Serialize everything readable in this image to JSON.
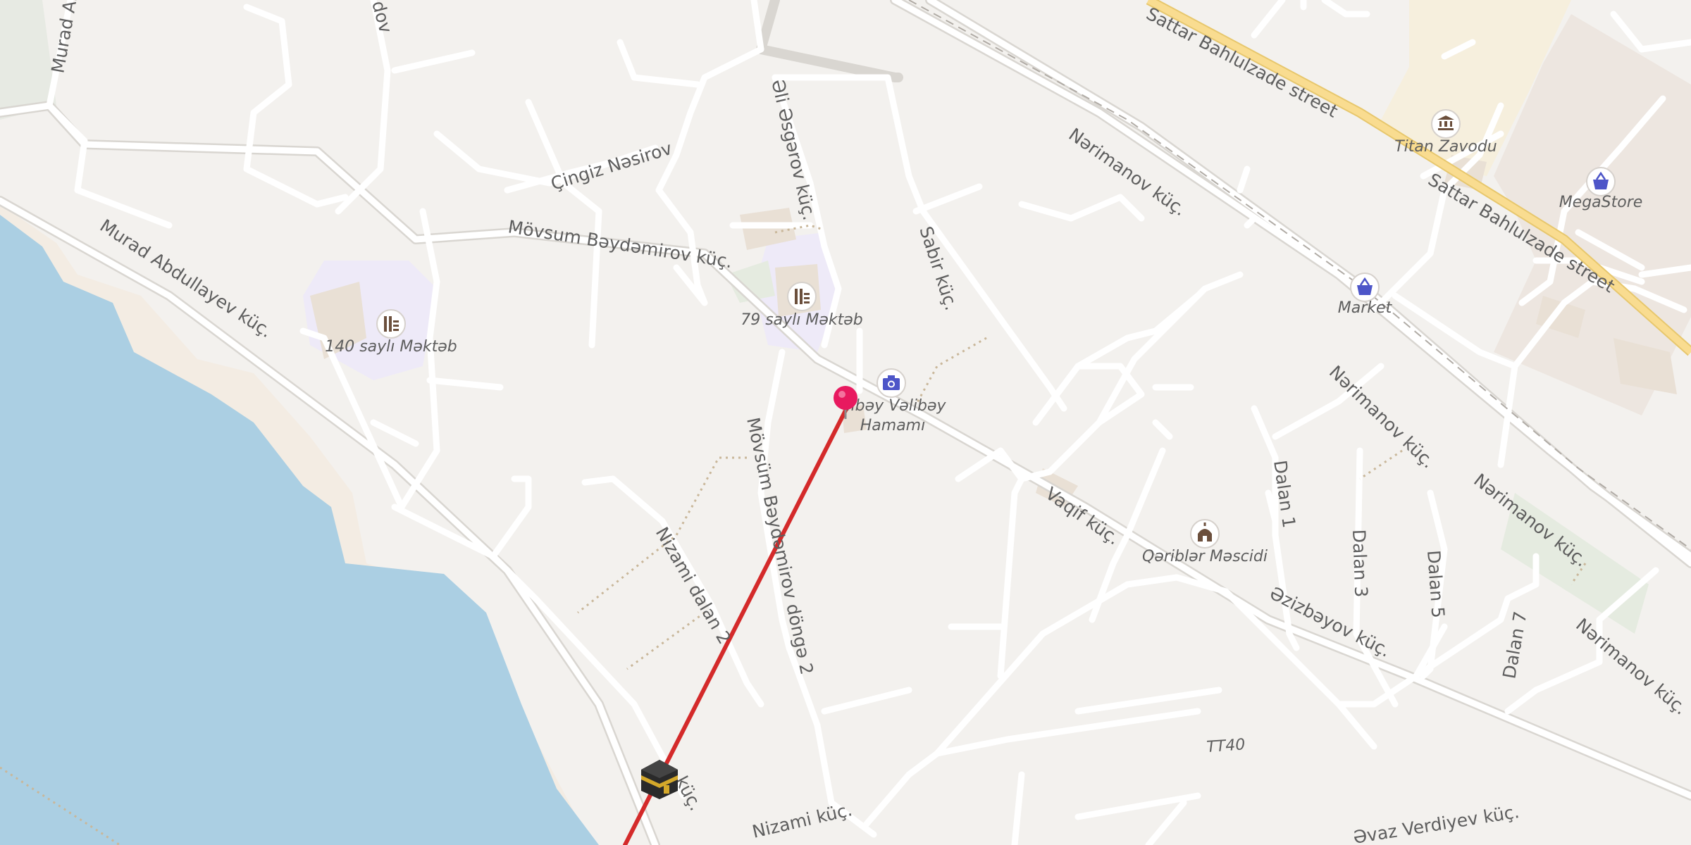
{
  "map": {
    "street_labels": [
      {
        "id": "sattar-1",
        "text": "Sattar Bahlulzade street"
      },
      {
        "id": "sattar-2",
        "text": "Sattar Bahlulzade street"
      },
      {
        "id": "narimanov-1",
        "text": "Nərimanov küç."
      },
      {
        "id": "narimanov-2",
        "text": "Nərimanov küç."
      },
      {
        "id": "narimanov-3",
        "text": "Nərimanov küç."
      },
      {
        "id": "narimanov-4",
        "text": "Nərimanov küç."
      },
      {
        "id": "ali-asgarov",
        "text": "Əli Əsgərov küç."
      },
      {
        "id": "cingiz",
        "text": "Çingiz Nəsirov"
      },
      {
        "id": "movsum-1",
        "text": "Mövsum Bəydəmirov küç."
      },
      {
        "id": "movsum-dongə",
        "text": "Mövsüm Bəydəmirov döngə 2"
      },
      {
        "id": "murad",
        "text": "Murad Abdullayev küç."
      },
      {
        "id": "murad-top",
        "text": "Murad Ab"
      },
      {
        "id": "top-dov",
        "text": "dov"
      },
      {
        "id": "sabir",
        "text": "Sabir küç."
      },
      {
        "id": "vaqif",
        "text": "Vaqif küç."
      },
      {
        "id": "azizbayov",
        "text": "Əzizbəyov küç."
      },
      {
        "id": "dalan1",
        "text": "Dalan 1"
      },
      {
        "id": "dalan3",
        "text": "Dalan 3"
      },
      {
        "id": "dalan5",
        "text": "Dalan 5"
      },
      {
        "id": "dalan7",
        "text": "Dalan 7"
      },
      {
        "id": "nizami-dalan",
        "text": "Nizami dalan 2"
      },
      {
        "id": "nizami",
        "text": "Nizami küç."
      },
      {
        "id": "nizami-partial",
        "text": "küç."
      },
      {
        "id": "tt40",
        "text": "TT40"
      },
      {
        "id": "avaz",
        "text": "Əvaz Verdiyev küç."
      }
    ],
    "pois": [
      {
        "id": "titan",
        "text": "Titan Zavodu",
        "icon": "museum-icon"
      },
      {
        "id": "megastore",
        "text": "MegaStore",
        "icon": "shopping-basket-icon"
      },
      {
        "id": "market",
        "text": "Market",
        "icon": "shopping-basket-icon"
      },
      {
        "id": "school79",
        "text": "79 saylı Məktəb",
        "icon": "school-icon"
      },
      {
        "id": "school140",
        "text": "140 saylı Məktəb",
        "icon": "school-icon"
      },
      {
        "id": "hamam-1",
        "text": "libəy Vəlibəy",
        "icon": "camera-icon"
      },
      {
        "id": "hamam-2",
        "text": "Hamamı",
        "icon": ""
      },
      {
        "id": "mosque",
        "text": "Qəriblər Məscidi",
        "icon": "mosque-icon"
      }
    ],
    "markers": [
      {
        "id": "location-pin",
        "icon": "map-pin-icon",
        "color": "#e8195f"
      },
      {
        "id": "kaaba",
        "icon": "kaaba-icon"
      }
    ],
    "qibla_line_color": "#d42a2a",
    "colors": {
      "land": "#f3f1ee",
      "water": "#abcfe3",
      "beach": "#f3ece3",
      "major_road": "#f7d98e",
      "school_area": "#eeeaf8",
      "industrial": "#f6efdd",
      "building": "#e9e0d5"
    }
  }
}
